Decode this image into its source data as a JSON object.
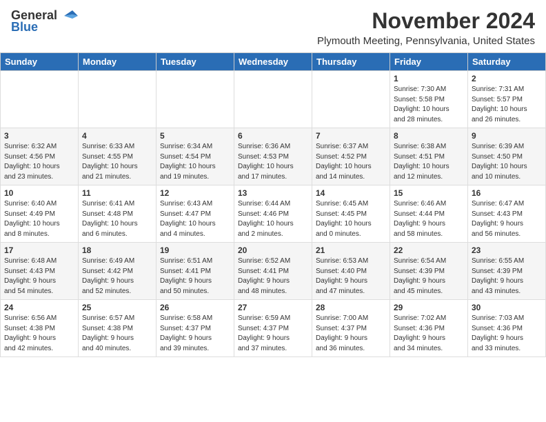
{
  "header": {
    "logo_general": "General",
    "logo_blue": "Blue",
    "month_title": "November 2024",
    "location": "Plymouth Meeting, Pennsylvania, United States"
  },
  "calendar": {
    "days_of_week": [
      "Sunday",
      "Monday",
      "Tuesday",
      "Wednesday",
      "Thursday",
      "Friday",
      "Saturday"
    ],
    "weeks": [
      [
        {
          "day": "",
          "info": ""
        },
        {
          "day": "",
          "info": ""
        },
        {
          "day": "",
          "info": ""
        },
        {
          "day": "",
          "info": ""
        },
        {
          "day": "",
          "info": ""
        },
        {
          "day": "1",
          "info": "Sunrise: 7:30 AM\nSunset: 5:58 PM\nDaylight: 10 hours\nand 28 minutes."
        },
        {
          "day": "2",
          "info": "Sunrise: 7:31 AM\nSunset: 5:57 PM\nDaylight: 10 hours\nand 26 minutes."
        }
      ],
      [
        {
          "day": "3",
          "info": "Sunrise: 6:32 AM\nSunset: 4:56 PM\nDaylight: 10 hours\nand 23 minutes."
        },
        {
          "day": "4",
          "info": "Sunrise: 6:33 AM\nSunset: 4:55 PM\nDaylight: 10 hours\nand 21 minutes."
        },
        {
          "day": "5",
          "info": "Sunrise: 6:34 AM\nSunset: 4:54 PM\nDaylight: 10 hours\nand 19 minutes."
        },
        {
          "day": "6",
          "info": "Sunrise: 6:36 AM\nSunset: 4:53 PM\nDaylight: 10 hours\nand 17 minutes."
        },
        {
          "day": "7",
          "info": "Sunrise: 6:37 AM\nSunset: 4:52 PM\nDaylight: 10 hours\nand 14 minutes."
        },
        {
          "day": "8",
          "info": "Sunrise: 6:38 AM\nSunset: 4:51 PM\nDaylight: 10 hours\nand 12 minutes."
        },
        {
          "day": "9",
          "info": "Sunrise: 6:39 AM\nSunset: 4:50 PM\nDaylight: 10 hours\nand 10 minutes."
        }
      ],
      [
        {
          "day": "10",
          "info": "Sunrise: 6:40 AM\nSunset: 4:49 PM\nDaylight: 10 hours\nand 8 minutes."
        },
        {
          "day": "11",
          "info": "Sunrise: 6:41 AM\nSunset: 4:48 PM\nDaylight: 10 hours\nand 6 minutes."
        },
        {
          "day": "12",
          "info": "Sunrise: 6:43 AM\nSunset: 4:47 PM\nDaylight: 10 hours\nand 4 minutes."
        },
        {
          "day": "13",
          "info": "Sunrise: 6:44 AM\nSunset: 4:46 PM\nDaylight: 10 hours\nand 2 minutes."
        },
        {
          "day": "14",
          "info": "Sunrise: 6:45 AM\nSunset: 4:45 PM\nDaylight: 10 hours\nand 0 minutes."
        },
        {
          "day": "15",
          "info": "Sunrise: 6:46 AM\nSunset: 4:44 PM\nDaylight: 9 hours\nand 58 minutes."
        },
        {
          "day": "16",
          "info": "Sunrise: 6:47 AM\nSunset: 4:43 PM\nDaylight: 9 hours\nand 56 minutes."
        }
      ],
      [
        {
          "day": "17",
          "info": "Sunrise: 6:48 AM\nSunset: 4:43 PM\nDaylight: 9 hours\nand 54 minutes."
        },
        {
          "day": "18",
          "info": "Sunrise: 6:49 AM\nSunset: 4:42 PM\nDaylight: 9 hours\nand 52 minutes."
        },
        {
          "day": "19",
          "info": "Sunrise: 6:51 AM\nSunset: 4:41 PM\nDaylight: 9 hours\nand 50 minutes."
        },
        {
          "day": "20",
          "info": "Sunrise: 6:52 AM\nSunset: 4:41 PM\nDaylight: 9 hours\nand 48 minutes."
        },
        {
          "day": "21",
          "info": "Sunrise: 6:53 AM\nSunset: 4:40 PM\nDaylight: 9 hours\nand 47 minutes."
        },
        {
          "day": "22",
          "info": "Sunrise: 6:54 AM\nSunset: 4:39 PM\nDaylight: 9 hours\nand 45 minutes."
        },
        {
          "day": "23",
          "info": "Sunrise: 6:55 AM\nSunset: 4:39 PM\nDaylight: 9 hours\nand 43 minutes."
        }
      ],
      [
        {
          "day": "24",
          "info": "Sunrise: 6:56 AM\nSunset: 4:38 PM\nDaylight: 9 hours\nand 42 minutes."
        },
        {
          "day": "25",
          "info": "Sunrise: 6:57 AM\nSunset: 4:38 PM\nDaylight: 9 hours\nand 40 minutes."
        },
        {
          "day": "26",
          "info": "Sunrise: 6:58 AM\nSunset: 4:37 PM\nDaylight: 9 hours\nand 39 minutes."
        },
        {
          "day": "27",
          "info": "Sunrise: 6:59 AM\nSunset: 4:37 PM\nDaylight: 9 hours\nand 37 minutes."
        },
        {
          "day": "28",
          "info": "Sunrise: 7:00 AM\nSunset: 4:37 PM\nDaylight: 9 hours\nand 36 minutes."
        },
        {
          "day": "29",
          "info": "Sunrise: 7:02 AM\nSunset: 4:36 PM\nDaylight: 9 hours\nand 34 minutes."
        },
        {
          "day": "30",
          "info": "Sunrise: 7:03 AM\nSunset: 4:36 PM\nDaylight: 9 hours\nand 33 minutes."
        }
      ]
    ]
  }
}
